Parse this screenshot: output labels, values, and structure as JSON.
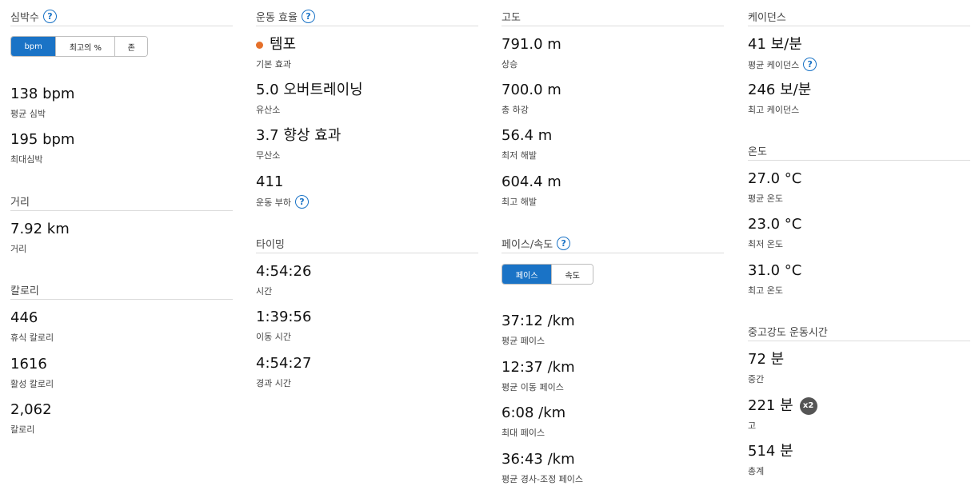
{
  "heart_rate": {
    "title": "심박수",
    "tabs": [
      "bpm",
      "최고의 %",
      "존"
    ],
    "avg": {
      "value": "138 bpm",
      "label": "평균 심박"
    },
    "max": {
      "value": "195 bpm",
      "label": "최대심박"
    }
  },
  "distance": {
    "title": "거리",
    "dist": {
      "value": "7.92 km",
      "label": "거리"
    }
  },
  "calories": {
    "title": "칼로리",
    "resting": {
      "value": "446",
      "label": "휴식 칼로리"
    },
    "active": {
      "value": "1616",
      "label": "활성 칼로리"
    },
    "total": {
      "value": "2,062",
      "label": "칼로리"
    }
  },
  "training_effect": {
    "title": "운동 효율",
    "primary": {
      "value": "템포",
      "label": "기본 효과"
    },
    "aerobic": {
      "value": "5.0 오버트레이닝",
      "label": "유산소"
    },
    "anaerobic": {
      "value": "3.7 향상 효과",
      "label": "무산소"
    },
    "load": {
      "value": "411",
      "label": "운동 부하"
    }
  },
  "timing": {
    "title": "타이밍",
    "time": {
      "value": "4:54:26",
      "label": "시간"
    },
    "moving": {
      "value": "1:39:56",
      "label": "이동 시간"
    },
    "elapsed": {
      "value": "4:54:27",
      "label": "경과 시간"
    }
  },
  "elevation": {
    "title": "고도",
    "gain": {
      "value": "791.0 m",
      "label": "상승"
    },
    "loss": {
      "value": "700.0 m",
      "label": "총 하강"
    },
    "min": {
      "value": "56.4 m",
      "label": "최저 해발"
    },
    "max": {
      "value": "604.4 m",
      "label": "최고 해발"
    }
  },
  "pace": {
    "title": "페이스/속도",
    "tabs": [
      "페이스",
      "속도"
    ],
    "avg": {
      "value": "37:12 /km",
      "label": "평균 페이스"
    },
    "avg_moving": {
      "value": "12:37 /km",
      "label": "평균 이동 페이스"
    },
    "best": {
      "value": "6:08 /km",
      "label": "최대 페이스"
    },
    "gap": {
      "value": "36:43 /km",
      "label": "평균 경사-조정 페이스"
    }
  },
  "cadence": {
    "title": "케이던스",
    "avg": {
      "value": "41 보/분",
      "label": "평균 케이던스"
    },
    "max": {
      "value": "246 보/분",
      "label": "최고 케이던스"
    }
  },
  "temperature": {
    "title": "온도",
    "avg": {
      "value": "27.0 °C",
      "label": "평균 온도"
    },
    "min": {
      "value": "23.0 °C",
      "label": "최저 온도"
    },
    "max": {
      "value": "31.0 °C",
      "label": "최고 온도"
    }
  },
  "intensity": {
    "title": "중고강도 운동시간",
    "moderate": {
      "value": "72 분",
      "label": "중간"
    },
    "vigorous": {
      "value": "221 분",
      "label": "고",
      "badge": "x2"
    },
    "total": {
      "value": "514 분",
      "label": "총계"
    }
  },
  "icons": {
    "help": "?"
  }
}
